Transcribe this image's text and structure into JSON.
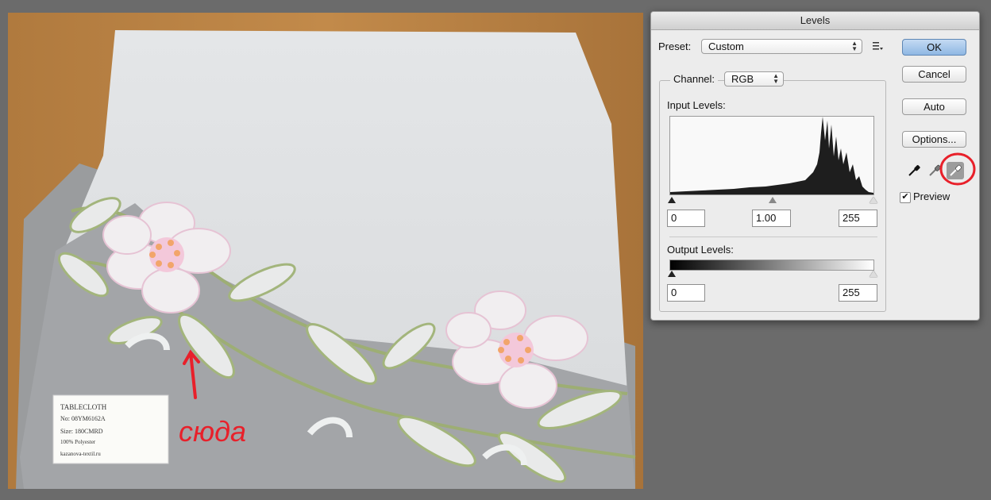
{
  "dialog": {
    "title": "Levels",
    "preset_label": "Preset:",
    "preset_value": "Custom",
    "channel_label": "Channel:",
    "channel_value": "RGB",
    "input_levels_label": "Input Levels:",
    "input_black": "0",
    "input_gamma": "1.00",
    "input_white": "255",
    "output_levels_label": "Output Levels:",
    "output_black": "0",
    "output_white": "255",
    "buttons": {
      "ok": "OK",
      "cancel": "Cancel",
      "auto": "Auto",
      "options": "Options..."
    },
    "preview_label": "Preview",
    "preview_checked": true
  },
  "photo": {
    "label_lines": [
      "TABLECLOTH",
      "No: 08YM6162A",
      "Size: 180CMRD",
      "100% Polyester",
      "kazanova-textil.ru"
    ],
    "annotation_text": "сюда"
  },
  "colors": {
    "annotation_red": "#e8202a",
    "accent_blue": "#8fb7e3"
  }
}
